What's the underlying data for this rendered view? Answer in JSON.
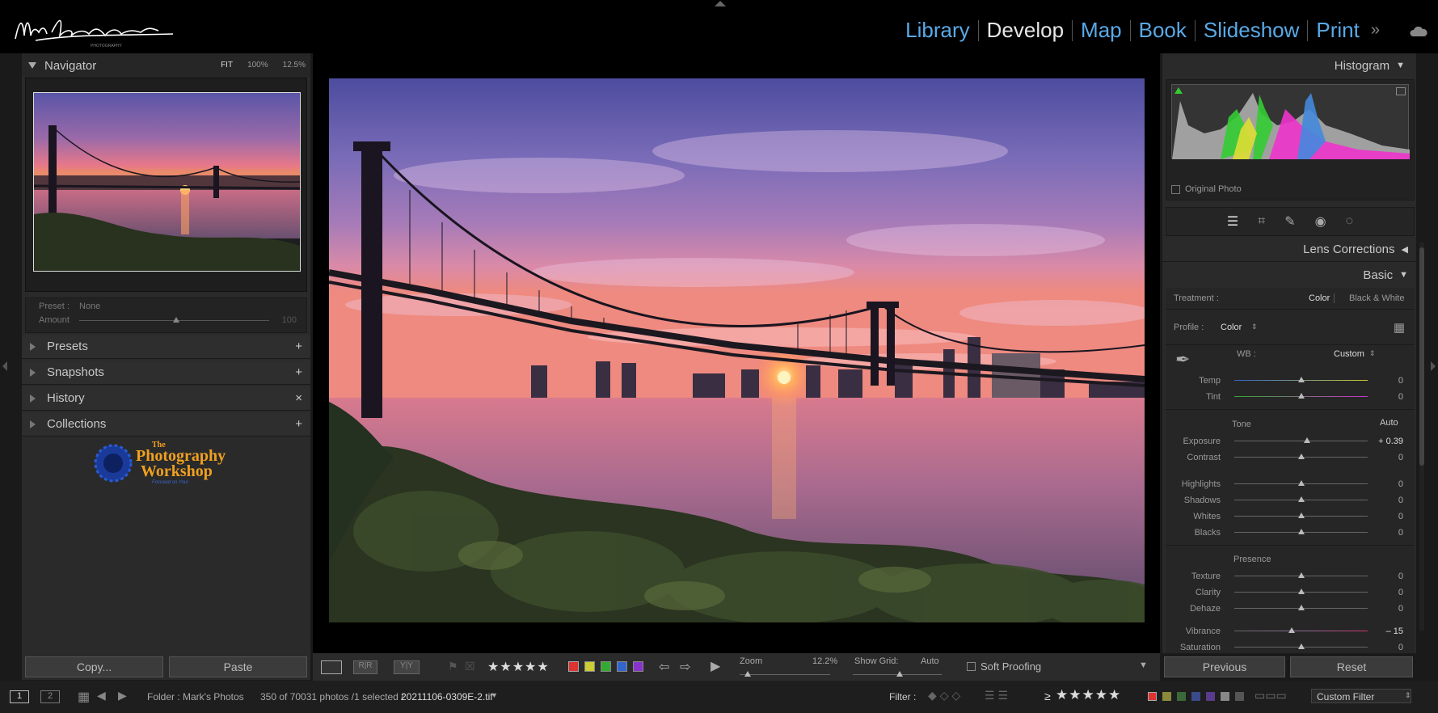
{
  "logo": {
    "alt": "Mark Bergkvist Photography"
  },
  "modules": [
    "Library",
    "Develop",
    "Map",
    "Book",
    "Slideshow",
    "Print"
  ],
  "active_module": "Develop",
  "left": {
    "navigator": {
      "title": "Navigator",
      "zoom": [
        "FIT",
        "100%",
        "12.5%"
      ]
    },
    "preset": {
      "preset_label": "Preset :",
      "preset_value": "None",
      "amount_label": "Amount",
      "amount_value": "100"
    },
    "sections": [
      {
        "label": "Presets",
        "action": "+"
      },
      {
        "label": "Snapshots",
        "action": "+"
      },
      {
        "label": "History",
        "action": "×"
      },
      {
        "label": "Collections",
        "action": "+"
      }
    ],
    "promo": {
      "line1": "The",
      "line2": "Photography",
      "line3": "Workshop",
      "line4": "Focused on You!"
    },
    "copy_label": "Copy...",
    "paste_label": "Paste"
  },
  "toolbar": {
    "zoom_label": "Zoom",
    "zoom_value": "12.2%",
    "grid_label": "Show Grid:",
    "grid_value": "Auto",
    "soft_proofing": "Soft Proofing",
    "stars": "★★★★★"
  },
  "right": {
    "histogram_title": "Histogram",
    "original_photo": "Original Photo",
    "lens_corrections": "Lens Corrections",
    "basic": "Basic",
    "treatment_label": "Treatment :",
    "treatment_color": "Color",
    "treatment_bw": "Black & White",
    "profile_label": "Profile :",
    "profile_value": "Color",
    "wb_label": "WB :",
    "wb_value": "Custom",
    "tone_label": "Tone",
    "auto_label": "Auto",
    "presence_label": "Presence",
    "sliders": {
      "temp": {
        "label": "Temp",
        "value": "0"
      },
      "tint": {
        "label": "Tint",
        "value": "0"
      },
      "exposure": {
        "label": "Exposure",
        "value": "+ 0.39"
      },
      "contrast": {
        "label": "Contrast",
        "value": "0"
      },
      "highlights": {
        "label": "Highlights",
        "value": "0"
      },
      "shadows": {
        "label": "Shadows",
        "value": "0"
      },
      "whites": {
        "label": "Whites",
        "value": "0"
      },
      "blacks": {
        "label": "Blacks",
        "value": "0"
      },
      "texture": {
        "label": "Texture",
        "value": "0"
      },
      "clarity": {
        "label": "Clarity",
        "value": "0"
      },
      "dehaze": {
        "label": "Dehaze",
        "value": "0"
      },
      "vibrance": {
        "label": "Vibrance",
        "value": "– 15"
      },
      "saturation": {
        "label": "Saturation",
        "value": "0"
      }
    },
    "previous_label": "Previous",
    "reset_label": "Reset"
  },
  "filmstrip": {
    "page1": "1",
    "page2": "2",
    "folder": "Folder : Mark's Photos",
    "count": "350 of 70031 photos /1 selected /",
    "filename": "20211106-0309E-2.tif",
    "filter_label": "Filter :",
    "rating_op": "≥",
    "stars": "★★★★★",
    "custom_filter": "Custom Filter"
  },
  "colors": {
    "accent": "#5aa9e6",
    "panel": "#2a2a2a",
    "label_red": "#d33",
    "label_yellow": "#cc3",
    "label_green": "#3a3",
    "label_blue": "#36c",
    "label_purple": "#83c"
  }
}
